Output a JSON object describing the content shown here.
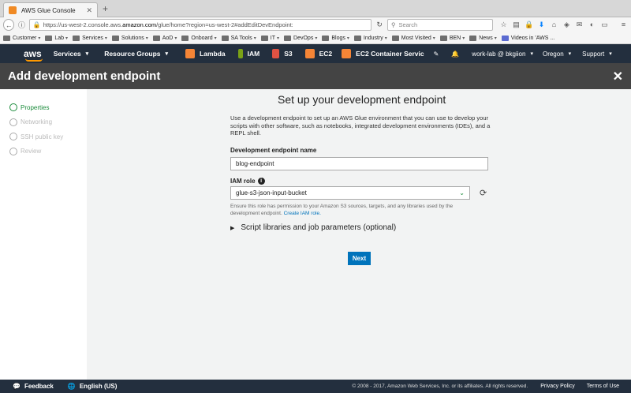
{
  "browser": {
    "tab_title": "AWS Glue Console",
    "url_prefix": "https://us-west-2.console.aws.",
    "url_domain": "amazon.com",
    "url_suffix": "/glue/home?region=us-west-2#addEditDevEndpoint:",
    "search_placeholder": "Search",
    "bookmarks": [
      "Customer",
      "Lab",
      "Services",
      "Solutions",
      "AoD",
      "Onboard",
      "SA Tools",
      "IT",
      "DevOps",
      "Blogs",
      "Industry",
      "Most Visited",
      "BEN",
      "News",
      "Videos in 'AWS ..."
    ]
  },
  "awsnav": {
    "logo": "aws",
    "services": "Services",
    "resource_groups": "Resource Groups",
    "shortcuts": [
      {
        "label": "Lambda",
        "color": "#f58536"
      },
      {
        "label": "IAM",
        "color": "#7aa116"
      },
      {
        "label": "S3",
        "color": "#e05243"
      },
      {
        "label": "EC2",
        "color": "#f58536"
      },
      {
        "label": "EC2 Container Servic",
        "color": "#f58536"
      }
    ],
    "account": "work-lab @ bkgiion",
    "region": "Oregon",
    "support": "Support"
  },
  "header": {
    "title": "Add development endpoint"
  },
  "steps": [
    {
      "label": "Properties",
      "active": true
    },
    {
      "label": "Networking",
      "active": false
    },
    {
      "label": "SSH public key",
      "active": false
    },
    {
      "label": "Review",
      "active": false
    }
  ],
  "form": {
    "heading": "Set up your development endpoint",
    "intro": "Use a development endpoint to set up an AWS Glue environment that you can use to develop your scripts with other software, such as notebooks, integrated development environments (IDEs), and a REPL shell.",
    "name_label": "Development endpoint name",
    "name_value": "blog-endpoint",
    "iam_label": "IAM role",
    "iam_value": "glue-s3-json-input-bucket",
    "iam_hint": "Ensure this role has permission to your Amazon S3 sources, targets, and any libraries used by the development endpoint.",
    "iam_link": "Create IAM role.",
    "expander": "Script libraries and job parameters (optional)",
    "next": "Next"
  },
  "footer": {
    "feedback": "Feedback",
    "language": "English (US)",
    "copyright": "© 2008 - 2017, Amazon Web Services, Inc. or its affiliates. All rights reserved.",
    "privacy": "Privacy Policy",
    "terms": "Terms of Use"
  }
}
